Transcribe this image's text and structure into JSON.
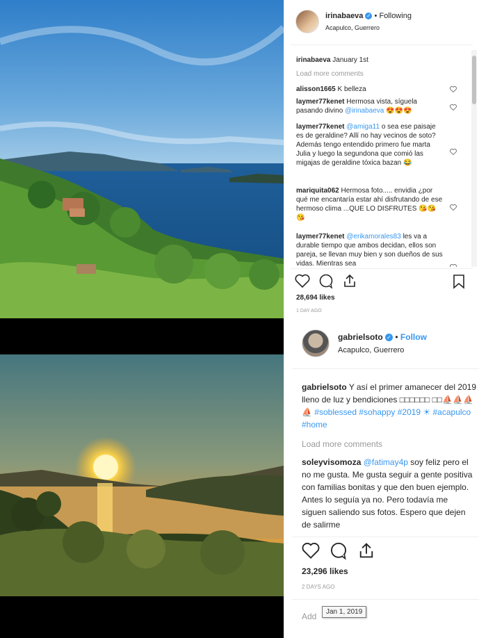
{
  "post1": {
    "username": "irinabaeva",
    "following": "Following",
    "location": "Acapulco, Guerrero",
    "caption_user": "irinabaeva",
    "caption_text": "January 1st",
    "load_more": "Load more comments",
    "comments": [
      {
        "user": "alisson1665",
        "text": "K belleza"
      },
      {
        "user": "laymer77kenet",
        "text": "Hermosa vista, síguela pasando divino",
        "mention": "@irinabaeva",
        "tail": "😍😍😍"
      },
      {
        "user": "laymer77kenet",
        "mention": "@amiga11",
        "text": "o sea ese paisaje es de geraldine? Allí no hay vecinos de soto? Además tengo entendido primero fue marta Julia y luego la segundona que comió las migajas de geraldine tóxica bazan 😂"
      },
      {
        "user": "mariquita062",
        "text": "Hermosa foto..... envidia ¿por qué me encantaría estar ahí disfrutando de ese hermoso clima ...QUE LO DISFRUTES 😘😘😘"
      },
      {
        "user": "laymer77kenet",
        "mention": "@erikamorales83",
        "text": "les va a durable tiempo que ambos decidan, ellos son pareja, se llevan muy bien y son dueños de sus vidas. Mientras sea"
      }
    ],
    "likes": "28,694 likes",
    "ago": "1 day ago"
  },
  "post2": {
    "username": "gabrielsoto",
    "follow": "Follow",
    "location": "Acapulco, Guerrero",
    "caption_user": "gabrielsoto",
    "caption_text": "Y así el primer amanecer del 2019 lleno de luz y bendiciones □□□□□□ □□⛵⛵⛵⛵",
    "caption_tags": "#soblessed #sohappy #2019 ☀ #acapulco #home",
    "load_more": "Load more comments",
    "comment_user": "soleyvisomoza",
    "comment_mention": "@fatimay4p",
    "comment_text": "soy feliz pero el no me gusta. Me gusta seguir a gente positiva con familias bonitas y que den buen ejemplo. Antes lo seguía ya no. Pero todavía me siguen saliendo sus fotos. Espero que dejen de salirme",
    "likes": "23,296 likes",
    "ago": "2 days ago",
    "add_comment": "Add",
    "tooltip": "Jan 1, 2019"
  },
  "colors": {
    "link": "#3897f0",
    "verified": "#3897f0",
    "muted": "#999999"
  }
}
